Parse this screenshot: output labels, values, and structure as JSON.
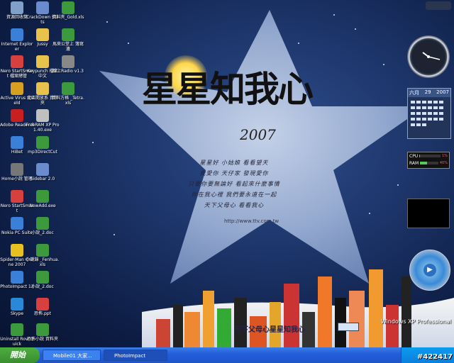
{
  "desktop": {
    "title_text": "星星知我心",
    "year": "2007",
    "poem_lines": [
      "星星好 小姑娘 看看望天",
      "我愛你 天仔家 發現愛你",
      "只要你要無論好 看起來什麼事情",
      "你在我心裡 我們要永遠在一起",
      "天下父母心 看看我心"
    ],
    "url": "http://www.ttv.com.tw",
    "bottom_text": "天下父母心星星知我心",
    "brand": "Windows XP Professional",
    "watermark": "#422417"
  },
  "icons": [
    {
      "label": "資源回收筒",
      "color": "#7fa0c8"
    },
    {
      "label": "CrackDown Stats",
      "color": "#6a8ccc"
    },
    {
      "label": "資料夾_Gold.xls",
      "color": "#3c9a3c"
    },
    {
      "label": "Internet Explorer",
      "color": "#3a7fd8"
    },
    {
      "label": "Jussy",
      "color": "#e8c24a"
    },
    {
      "label": "馬來公堂上 簿寫邊",
      "color": "#3c9a3c"
    },
    {
      "label": "Nero StartSmart 檔案總管",
      "color": "#d84040"
    },
    {
      "label": "Keypunch 檔案中文",
      "color": "#e8c24a"
    },
    {
      "label": "線上Radio v1.3",
      "color": "#888"
    },
    {
      "label": "Active Virus Shield",
      "color": "#d8a020"
    },
    {
      "label": "北區開放系 資料夾",
      "color": "#e8c24a"
    },
    {
      "label": "資料方格 _Tetra.xls",
      "color": "#3c9a3c"
    },
    {
      "label": "Adobe Reader 8",
      "color": "#c82020"
    },
    {
      "label": "FreeRAM XP Pro 1.40.exe",
      "color": "#c0c0c0"
    },
    {
      "label": "HiBet",
      "color": "#3a7fd8"
    },
    {
      "label": "mp3DirectCut",
      "color": "#3c9a3c"
    },
    {
      "label": "Home小說 管理",
      "color": "#777"
    },
    {
      "label": "Sidebar 2.0",
      "color": "#6a8ccc"
    },
    {
      "label": "Nero StartSmart",
      "color": "#d84040"
    },
    {
      "label": "NewAdd.exe",
      "color": "#3c9a3c"
    },
    {
      "label": "Nokia PC Suite",
      "color": "#3a7fd8"
    },
    {
      "label": "小說_2.doc",
      "color": "#3c9a3c"
    },
    {
      "label": "Spider-Man Online 2007",
      "color": "#e8c020"
    },
    {
      "label": "小說錄 _Fenhua.xls",
      "color": "#3c9a3c"
    },
    {
      "label": "PhotoImpact 12",
      "color": "#3a7fd8"
    },
    {
      "label": "小說_2.doc",
      "color": "#3c9a3c"
    },
    {
      "label": "Skype",
      "color": "#2a88d8"
    },
    {
      "label": "恐怖.ppt",
      "color": "#d84040"
    },
    {
      "label": "Uninstall Rovi Quick",
      "color": "#3c9a3c"
    },
    {
      "label": "恐怖小說 資料夾",
      "color": "#3c9a3c"
    }
  ],
  "gadgets": {
    "calendar": {
      "month": "六月",
      "day": "29",
      "year": "2007"
    },
    "cpu_label": "CPU",
    "ram_label": "RAM",
    "cpu_value": "1%",
    "ram_value": "40%",
    "cpu_level": 0.01,
    "ram_level": 0.4
  },
  "taskbar": {
    "start_label": "開始",
    "tasks": [
      {
        "label": "Mobile01 大家..."
      },
      {
        "label": "PhotoImpact"
      }
    ]
  }
}
